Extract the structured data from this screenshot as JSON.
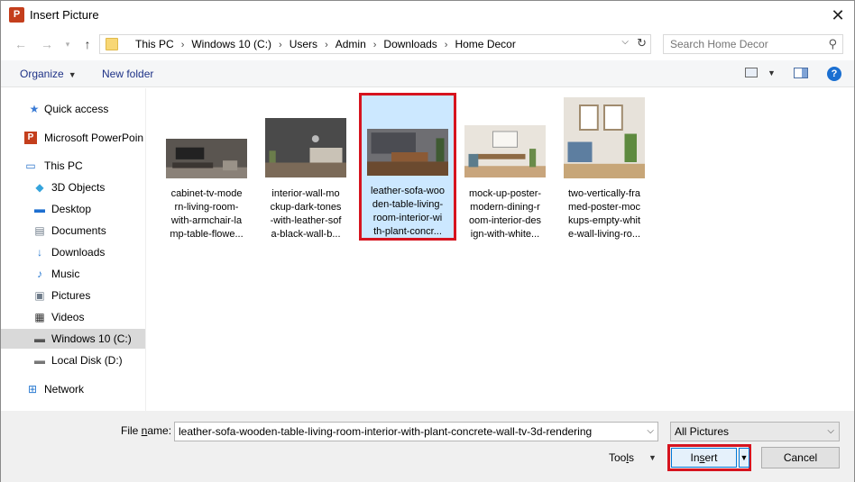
{
  "window": {
    "title": "Insert Picture",
    "app_icon_letter": "P"
  },
  "address": {
    "crumbs": [
      "This PC",
      "Windows 10 (C:)",
      "Users",
      "Admin",
      "Downloads",
      "Home Decor"
    ]
  },
  "search": {
    "placeholder": "Search Home Decor"
  },
  "toolbar": {
    "organize": "Organize",
    "new_folder": "New folder",
    "help": "?"
  },
  "sidebar": {
    "items": [
      {
        "label": "Quick access",
        "icon": "star-icon"
      },
      {
        "label": "Microsoft PowerPoin",
        "icon": "powerpoint-icon"
      },
      {
        "label": "This PC",
        "icon": "computer-icon"
      },
      {
        "label": "3D Objects",
        "icon": "cube-icon"
      },
      {
        "label": "Desktop",
        "icon": "desktop-icon"
      },
      {
        "label": "Documents",
        "icon": "document-icon"
      },
      {
        "label": "Downloads",
        "icon": "download-icon"
      },
      {
        "label": "Music",
        "icon": "music-icon"
      },
      {
        "label": "Pictures",
        "icon": "pictures-icon"
      },
      {
        "label": "Videos",
        "icon": "video-icon"
      },
      {
        "label": "Windows 10 (C:)",
        "icon": "drive-icon"
      },
      {
        "label": "Local Disk (D:)",
        "icon": "drive-icon"
      },
      {
        "label": "Network",
        "icon": "network-icon"
      }
    ]
  },
  "files": [
    {
      "name": "cabinet-tv-modern-living-room-with-armchair-lamp-table-flowe...",
      "lines": [
        "cabinet-tv-mode",
        "rn-living-room-",
        "with-armchair-la",
        "mp-table-flowe..."
      ]
    },
    {
      "name": "interior-wall-mockup-dark-tones-with-leather-sofa-black-wall-b...",
      "lines": [
        "interior-wall-mo",
        "ckup-dark-tones",
        "-with-leather-sof",
        "a-black-wall-b..."
      ]
    },
    {
      "name": "leather-sofa-wooden-table-living-room-interior-with-plant-concr...",
      "lines": [
        "leather-sofa-woo",
        "den-table-living-",
        "room-interior-wi",
        "th-plant-concr..."
      ]
    },
    {
      "name": "mock-up-poster-modern-dining-room-interior-design-with-white...",
      "lines": [
        "mock-up-poster-",
        "modern-dining-r",
        "oom-interior-des",
        "ign-with-white..."
      ]
    },
    {
      "name": "two-vertically-framed-poster-mockups-empty-white-wall-living-ro...",
      "lines": [
        "two-vertically-fra",
        "med-poster-moc",
        "kups-empty-whit",
        "e-wall-living-ro..."
      ]
    }
  ],
  "footer": {
    "file_name_label_pre": "File ",
    "file_name_label_key": "n",
    "file_name_label_post": "ame:",
    "file_name_value": "leather-sofa-wooden-table-living-room-interior-with-plant-concrete-wall-tv-3d-rendering",
    "file_type": "All Pictures",
    "tools_pre": "Too",
    "tools_key": "l",
    "tools_post": "s",
    "insert_pre": "In",
    "insert_key": "s",
    "insert_post": "ert",
    "cancel": "Cancel"
  },
  "colors": {
    "highlight": "#d6141f",
    "selection_bg": "#cce8ff",
    "link_blue": "#1e3287"
  }
}
